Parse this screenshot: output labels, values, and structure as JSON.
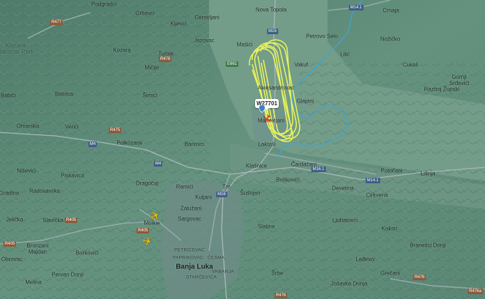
{
  "map": {
    "places": [
      {
        "id": "podgradci",
        "name": "Podgradci",
        "type": "town"
      },
      {
        "id": "grbavci",
        "name": "Grbavci",
        "type": "town"
      },
      {
        "id": "cerovljani",
        "name": "Cerovljani",
        "type": "town"
      },
      {
        "id": "nova-topola",
        "name": "Nova Topola",
        "type": "town"
      },
      {
        "id": "crnaja",
        "name": "Crnaja",
        "type": "town"
      },
      {
        "id": "kozara-np",
        "name": "Kozara\nNational Park",
        "type": "region"
      },
      {
        "id": "kijevci",
        "name": "Kijevci",
        "type": "town"
      },
      {
        "id": "jazovac",
        "name": "Jazovac",
        "type": "town"
      },
      {
        "id": "masici",
        "name": "Mašići",
        "type": "town"
      },
      {
        "id": "petrovo-selo",
        "name": "Petrovo Selo",
        "type": "town"
      },
      {
        "id": "licic",
        "name": "Lilić",
        "type": "town"
      },
      {
        "id": "nozicko",
        "name": "Nožičko",
        "type": "town"
      },
      {
        "id": "kozara",
        "name": "Kozara",
        "type": "town"
      },
      {
        "id": "turjak",
        "name": "Turjak",
        "type": "town"
      },
      {
        "id": "micije",
        "name": "Mičije",
        "type": "town"
      },
      {
        "id": "vakuf",
        "name": "Vakuf",
        "type": "town"
      },
      {
        "id": "cukali",
        "name": "Cukali",
        "type": "town"
      },
      {
        "id": "gornji-srdjevici",
        "name": "Gornji\nSrđevići",
        "type": "town"
      },
      {
        "id": "babici",
        "name": "Babići",
        "type": "town"
      },
      {
        "id": "bistrica",
        "name": "Bistrica",
        "type": "town"
      },
      {
        "id": "simici",
        "name": "Šimići",
        "type": "town"
      },
      {
        "id": "aleksandrovac",
        "name": "Aleksandrovac",
        "type": "town"
      },
      {
        "id": "glajani",
        "name": "Glajani",
        "type": "town"
      },
      {
        "id": "razboj-zupski",
        "name": "Razboj Župski",
        "type": "town"
      },
      {
        "id": "omarska",
        "name": "Omarska",
        "type": "town"
      },
      {
        "id": "verici",
        "name": "Verići",
        "type": "town"
      },
      {
        "id": "mahovljani",
        "name": "Mahovljani",
        "type": "town"
      },
      {
        "id": "polkozarje",
        "name": "Polkozarje",
        "type": "town"
      },
      {
        "id": "barlovci",
        "name": "Barlovci",
        "type": "town"
      },
      {
        "id": "lauktasi",
        "name": "Laktaši",
        "type": "town"
      },
      {
        "id": "klasnice",
        "name": "Klašnice",
        "type": "town"
      },
      {
        "id": "cardacani",
        "name": "Čardačani",
        "type": "town"
      },
      {
        "id": "potocani",
        "name": "Potočani",
        "type": "town"
      },
      {
        "id": "nisevici",
        "name": "Niševići",
        "type": "town"
      },
      {
        "id": "piskavica",
        "name": "Piskavica",
        "type": "town"
      },
      {
        "id": "bosnici",
        "name": "Boškovići",
        "type": "town"
      },
      {
        "id": "lisnja",
        "name": "Lišnja",
        "type": "town"
      },
      {
        "id": "dragocaj",
        "name": "Dragočaj",
        "type": "town"
      },
      {
        "id": "ramici",
        "name": "Ramići",
        "type": "town"
      },
      {
        "id": "tm",
        "name": "Tm",
        "type": "town"
      },
      {
        "id": "susnjari",
        "name": "Šušnjari",
        "type": "town"
      },
      {
        "id": "devetina",
        "name": "Devetina",
        "type": "town"
      },
      {
        "id": "gradina",
        "name": "Gradina",
        "type": "town"
      },
      {
        "id": "radosavska",
        "name": "Radosavska",
        "type": "town"
      },
      {
        "id": "kuljani",
        "name": "Kuljani",
        "type": "town"
      },
      {
        "id": "cirkvena",
        "name": "Cirkvena",
        "type": "town"
      },
      {
        "id": "zaluzani",
        "name": "Zalužani",
        "type": "town"
      },
      {
        "id": "jelicka",
        "name": "Jelička",
        "type": "town"
      },
      {
        "id": "slavicka",
        "name": "Slavička",
        "type": "town"
      },
      {
        "id": "molkie",
        "name": "Molkie",
        "type": "town"
      },
      {
        "id": "sargovac",
        "name": "Sargovac",
        "type": "town"
      },
      {
        "id": "ljubatovci",
        "name": "Ljubatovci",
        "type": "town"
      },
      {
        "id": "slatina",
        "name": "Slatina",
        "type": "town"
      },
      {
        "id": "kokori",
        "name": "Kokori",
        "type": "town"
      },
      {
        "id": "bronzani-majdan",
        "name": "Bronzani\nMajdan",
        "type": "town"
      },
      {
        "id": "obrovac",
        "name": "Obrovac",
        "type": "town"
      },
      {
        "id": "borkovici",
        "name": "Borkovići",
        "type": "town"
      },
      {
        "id": "petricevac",
        "name": "PETRIĆEVAC",
        "type": "district"
      },
      {
        "id": "paprikovac",
        "name": "PAPRIKOVAC",
        "type": "district"
      },
      {
        "id": "cesma",
        "name": "ČESMA",
        "type": "district"
      },
      {
        "id": "banja-luka",
        "name": "Banja Luka",
        "type": "city"
      },
      {
        "id": "starcevica",
        "name": "STARČEVICA",
        "type": "district"
      },
      {
        "id": "vrbanja",
        "name": "VRBANJA",
        "type": "district"
      },
      {
        "id": "branesci-donji",
        "name": "Branešci Donji",
        "type": "town"
      },
      {
        "id": "pervan-donji",
        "name": "Pervan Donji",
        "type": "town"
      },
      {
        "id": "ladevci",
        "name": "Lađevci",
        "type": "town"
      },
      {
        "id": "melina",
        "name": "Melina",
        "type": "town"
      },
      {
        "id": "srbac",
        "name": "Šrbe",
        "type": "town"
      },
      {
        "id": "josavka-donja",
        "name": "Jošavka Donja",
        "type": "town"
      },
      {
        "id": "grecani",
        "name": "Grečani",
        "type": "town"
      }
    ],
    "road_shields": [
      {
        "id": "r477",
        "label": "R477",
        "kind": "r"
      },
      {
        "id": "m141-top",
        "label": "M14.1",
        "kind": "m"
      },
      {
        "id": "r478",
        "label": "R478",
        "kind": "r"
      },
      {
        "id": "m16-top",
        "label": "M16",
        "kind": "m"
      },
      {
        "id": "e661",
        "label": "E661",
        "kind": "e"
      },
      {
        "id": "r475",
        "label": "R475",
        "kind": "r"
      },
      {
        "id": "m4-left",
        "label": "M4",
        "kind": "m"
      },
      {
        "id": "m4-mid",
        "label": "M4",
        "kind": "m"
      },
      {
        "id": "m161",
        "label": "M16.1",
        "kind": "m"
      },
      {
        "id": "m141-right",
        "label": "M14.1",
        "kind": "m"
      },
      {
        "id": "m16-mid",
        "label": "M16",
        "kind": "m"
      },
      {
        "id": "r405-a",
        "label": "R405",
        "kind": "r"
      },
      {
        "id": "r405-b",
        "label": "R405",
        "kind": "r"
      },
      {
        "id": "r405-c",
        "label": "R405",
        "kind": "r"
      },
      {
        "id": "r476-a",
        "label": "R476",
        "kind": "r"
      },
      {
        "id": "r476-b",
        "label": "R476",
        "kind": "r"
      },
      {
        "id": "r476a",
        "label": "R476a",
        "kind": "r"
      }
    ],
    "tracked_flight": {
      "callsign": "W27701",
      "track_color": "#e9f35a"
    },
    "colors": {
      "terrain": "#5d8a79",
      "roads": "#9aaeb0",
      "river": "#3aa6d8",
      "track": "#e9f35a",
      "plane": "#f2c20f"
    }
  }
}
